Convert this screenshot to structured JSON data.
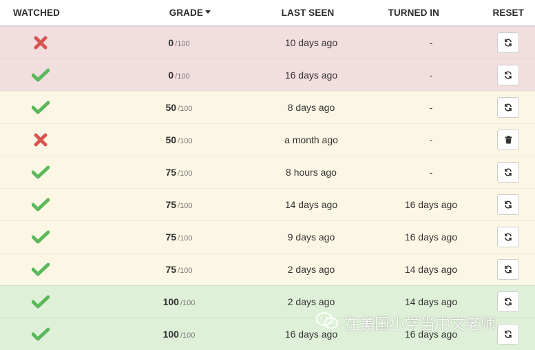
{
  "header": {
    "watched": "WATCHED",
    "grade": "GRADE",
    "last_seen": "LAST SEEN",
    "turned_in": "TURNED IN",
    "reset": "RESET"
  },
  "rows": [
    {
      "status": "danger",
      "watched": false,
      "grade": "0",
      "grade_max": "/100",
      "last_seen": "10 days ago",
      "turned_in": "-",
      "reset_icon": "refresh-icon"
    },
    {
      "status": "danger",
      "watched": true,
      "grade": "0",
      "grade_max": "/100",
      "last_seen": "16 days ago",
      "turned_in": "-",
      "reset_icon": "refresh-icon"
    },
    {
      "status": "warning",
      "watched": true,
      "grade": "50",
      "grade_max": "/100",
      "last_seen": "8 days ago",
      "turned_in": "-",
      "reset_icon": "refresh-icon"
    },
    {
      "status": "warning",
      "watched": false,
      "grade": "50",
      "grade_max": "/100",
      "last_seen": "a month ago",
      "turned_in": "-",
      "reset_icon": "trash-icon"
    },
    {
      "status": "warning",
      "watched": true,
      "grade": "75",
      "grade_max": "/100",
      "last_seen": "8 hours ago",
      "turned_in": "-",
      "reset_icon": "refresh-icon"
    },
    {
      "status": "warning",
      "watched": true,
      "grade": "75",
      "grade_max": "/100",
      "last_seen": "14 days ago",
      "turned_in": "16 days ago",
      "reset_icon": "refresh-icon"
    },
    {
      "status": "warning",
      "watched": true,
      "grade": "75",
      "grade_max": "/100",
      "last_seen": "9 days ago",
      "turned_in": "16 days ago",
      "reset_icon": "refresh-icon"
    },
    {
      "status": "warning",
      "watched": true,
      "grade": "75",
      "grade_max": "/100",
      "last_seen": "2 days ago",
      "turned_in": "14 days ago",
      "reset_icon": "refresh-icon"
    },
    {
      "status": "success",
      "watched": true,
      "grade": "100",
      "grade_max": "/100",
      "last_seen": "2 days ago",
      "turned_in": "14 days ago",
      "reset_icon": "refresh-icon"
    },
    {
      "status": "success",
      "watched": true,
      "grade": "100",
      "grade_max": "/100",
      "last_seen": "16 days ago",
      "turned_in": "16 days ago",
      "reset_icon": "refresh-icon"
    }
  ],
  "colors": {
    "check": "#5cb85c",
    "cross": "#d9534f",
    "danger_row": "#f2dede",
    "warning_row": "#fcf7e4",
    "success_row": "#dff0d8"
  },
  "watermark": {
    "text": "在美国小学当中文老师",
    "icon": "wechat-icon"
  }
}
